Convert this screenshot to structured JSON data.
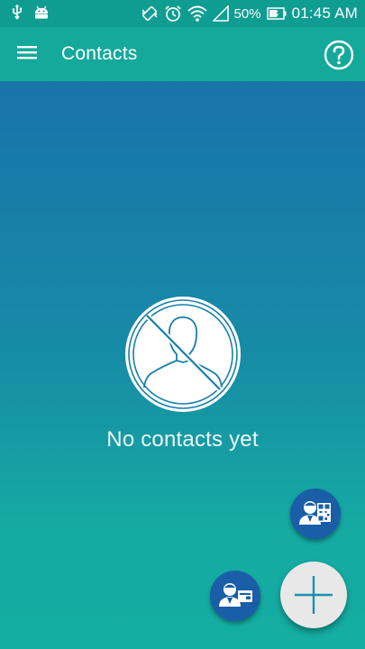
{
  "status_bar": {
    "battery_percent": "50%",
    "time": "01:45 AM",
    "icons": [
      "usb-icon",
      "android-icon",
      "vibrate-icon",
      "alarm-icon",
      "wifi-icon",
      "signal-icon",
      "battery-icon"
    ]
  },
  "app_bar": {
    "menu_icon": "hamburger-menu-icon",
    "title": "Contacts",
    "help_icon": "help-circle-icon"
  },
  "empty_state": {
    "icon": "no-contacts-icon",
    "message": "No contacts yet"
  },
  "fabs": {
    "qr_icon": "person-qr-icon",
    "card_icon": "person-card-icon",
    "main_icon": "plus-icon"
  },
  "colors": {
    "app_bar": "#14a99b",
    "status_bar": "#0f9d92",
    "background_top": "#1a70a8",
    "background_bottom": "#14aea2",
    "fab_small": "#1a5ea8",
    "fab_main": "#e8e8e8",
    "plus": "#1a8fb0"
  }
}
